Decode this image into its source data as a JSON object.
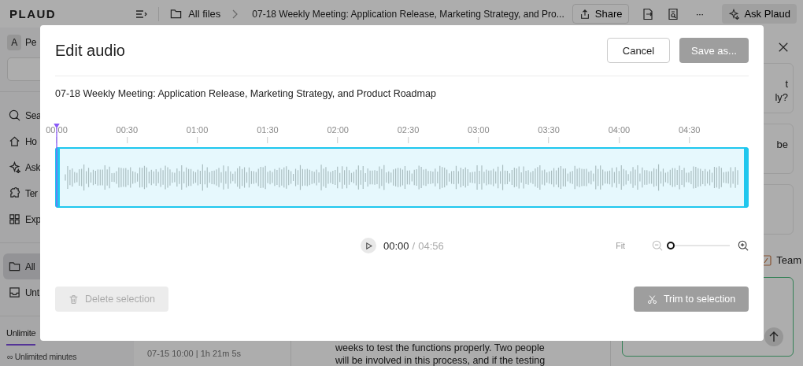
{
  "app": {
    "logo": "PLAUD"
  },
  "topbar": {
    "breadcrumb": [
      "All files",
      "07-18 Weekly Meeting: Application Release, Marketing Strategy, and Pro..."
    ],
    "share": "Share",
    "more": "···",
    "ask": "Ask Plaud"
  },
  "sidebar": {
    "user": {
      "initial": "A",
      "name": "Pe"
    },
    "nav": [
      {
        "label": "Sea"
      },
      {
        "label": "Ho"
      },
      {
        "label": "Ask"
      },
      {
        "label": "Ter"
      },
      {
        "label": "Exp"
      }
    ],
    "folders": [
      {
        "label": "All",
        "selected": true
      },
      {
        "label": "Unt",
        "selected": false
      }
    ],
    "plan_tab": "Unlimite",
    "plan_note": "∞ Unlimited minutes"
  },
  "file_list": [
    {
      "meta": "07-15 10:00 | 1h 21m 5s"
    }
  ],
  "transcript": [
    "weeks to test the functions properly. Two people",
    "will be involved in this process, and if the testing"
  ],
  "right_panel": {
    "cards": [
      [
        "t",
        "ly?"
      ],
      [
        "be"
      ]
    ],
    "team": "Team"
  },
  "dialog": {
    "title": "Edit audio",
    "buttons": [
      {
        "label": "Cancel",
        "disabled": false
      },
      {
        "label": "Save as...",
        "disabled": true
      }
    ],
    "file_name": "07-18 Weekly Meeting: Application Release, Marketing Strategy, and Product Roadmap",
    "ticks": [
      "00:00",
      "00:30",
      "01:00",
      "01:30",
      "02:00",
      "02:30",
      "03:00",
      "03:30",
      "04:00",
      "04:30"
    ],
    "player": {
      "current": "00:00",
      "separator": "/",
      "total": "04:56"
    },
    "zoom": {
      "fit": "Fit",
      "level": 0
    },
    "actions": [
      {
        "label": "Delete selection",
        "disabled": true
      },
      {
        "label": "Trim to selection",
        "disabled": true
      }
    ]
  }
}
